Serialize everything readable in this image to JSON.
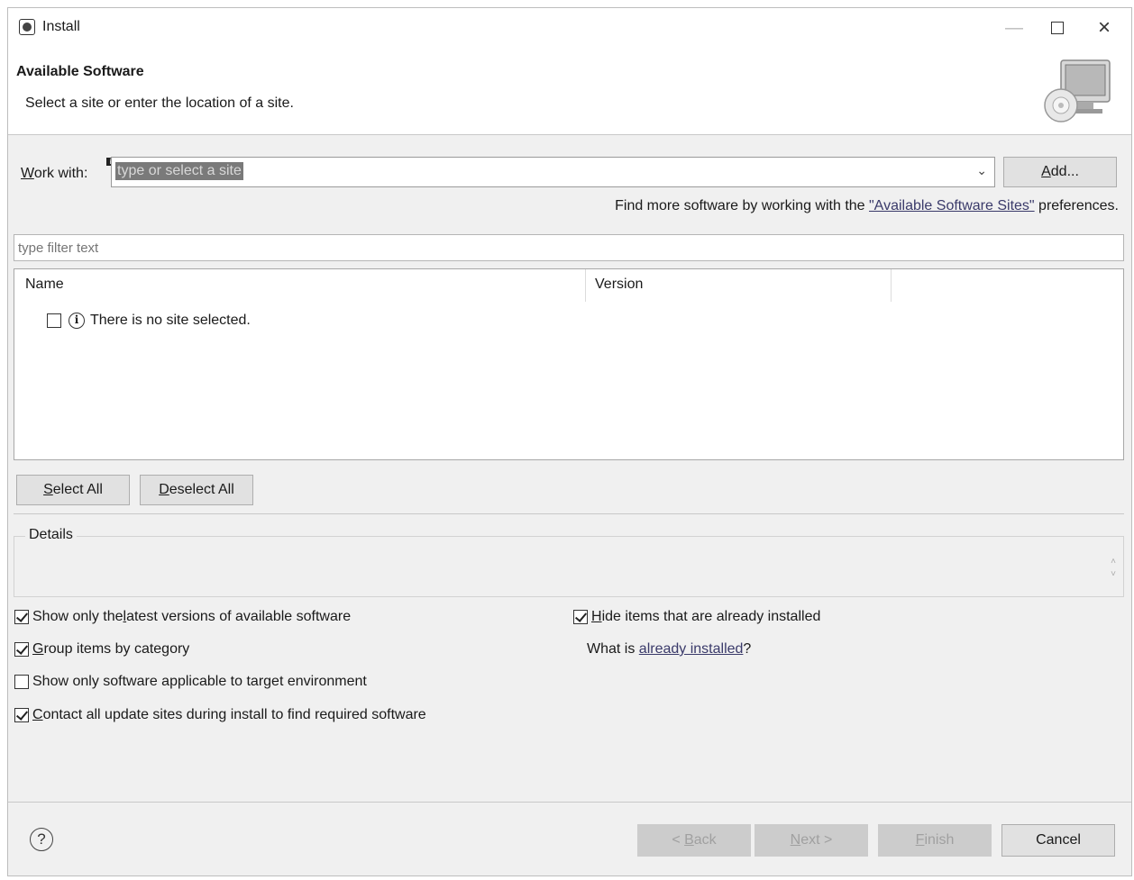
{
  "window": {
    "title": "Install",
    "header_title": "Available Software",
    "header_subtitle": "Select a site or enter the location of a site."
  },
  "work_with": {
    "label_accel": "W",
    "label_rest": "ork with:",
    "value": "type or select a site",
    "add_label_accel": "A",
    "add_label_rest": "dd..."
  },
  "find_more": {
    "prefix": "Find more software by working with the ",
    "link": "\"Available Software Sites\"",
    "suffix": " preferences."
  },
  "filter": {
    "placeholder": "type filter text"
  },
  "tree": {
    "columns": [
      "Name",
      "Version"
    ],
    "message": "There is no site selected."
  },
  "buttons": {
    "select_all_accel": "S",
    "select_all_rest": "elect All",
    "deselect_all_accel": "D",
    "deselect_all_rest": "eselect All"
  },
  "details": {
    "label": "Details"
  },
  "options": {
    "latest_pre": "Show only the ",
    "latest_accel": "l",
    "latest_post": "atest versions of available software",
    "latest_checked": true,
    "group_accel": "G",
    "group_post": "roup items by category",
    "group_checked": true,
    "target_text": "Show only software applicable to target environment",
    "target_checked": false,
    "contact_accel": "C",
    "contact_post": "ontact all update sites during install to find required software",
    "contact_checked": true,
    "hide_accel": "H",
    "hide_post": "ide items that are already installed",
    "hide_checked": true,
    "what_is_prefix": "What is ",
    "what_is_link": "already installed",
    "what_is_suffix": "?"
  },
  "footer": {
    "back_pre": "< ",
    "back_accel": "B",
    "back_post": "ack",
    "next_accel": "N",
    "next_post": "ext >",
    "finish_accel": "F",
    "finish_post": "inish",
    "cancel": "Cancel"
  }
}
